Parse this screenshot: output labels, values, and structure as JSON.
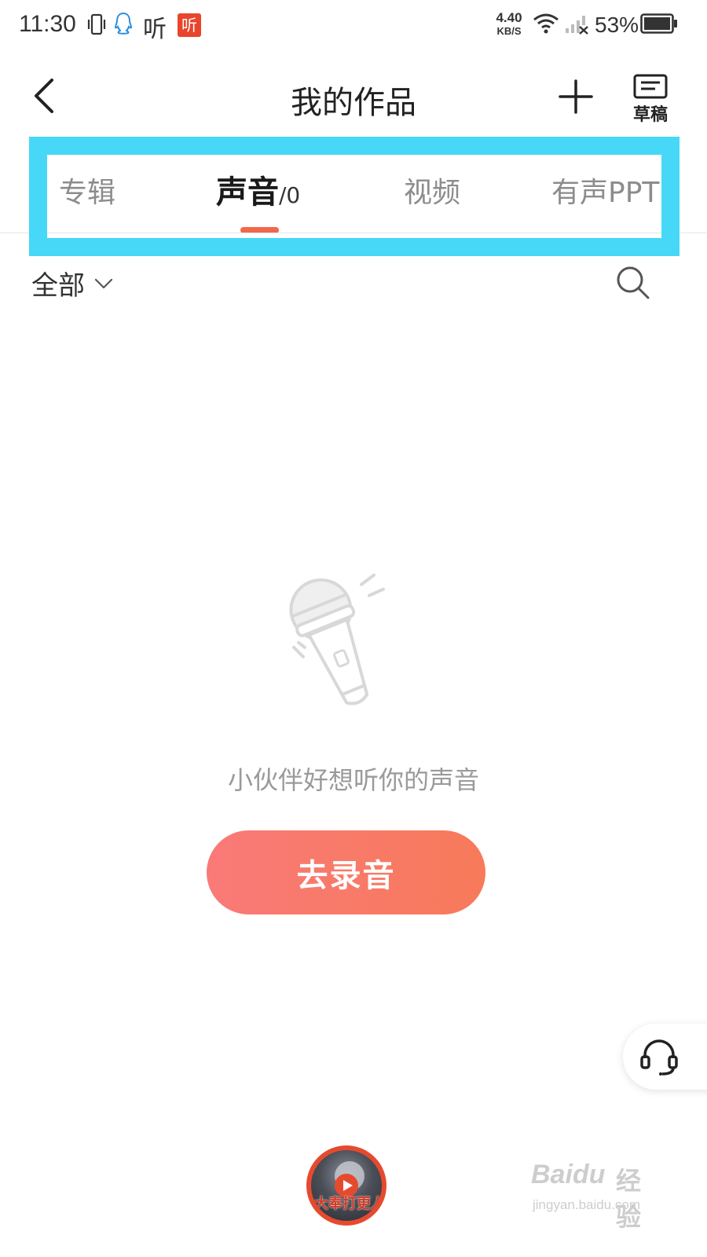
{
  "status_bar": {
    "time": "11:30",
    "ting_text": "听",
    "ting_badge": "听",
    "net_speed_value": "4.40",
    "net_speed_unit": "KB/S",
    "battery": "53%"
  },
  "nav": {
    "title": "我的作品",
    "draft_label": "草稿"
  },
  "tabs": {
    "items": [
      {
        "label": "专辑"
      },
      {
        "label": "声音",
        "count": "/0"
      },
      {
        "label": "视频"
      },
      {
        "label": "有声PPT"
      }
    ],
    "active_index": 1,
    "highlight_color": "#46d8f6",
    "indicator_color": "#f2674a"
  },
  "filter": {
    "selected": "全部"
  },
  "empty_state": {
    "message": "小伙伴好想听你的声音",
    "button_label": "去录音",
    "button_gradient": [
      "#f97a78",
      "#f77a5a"
    ]
  },
  "mini_player": {
    "cover_text": "大奉打更人"
  },
  "watermark": {
    "brand": "Baidu",
    "brand_cn": "经验",
    "domain": "jingyan.baidu.com"
  }
}
